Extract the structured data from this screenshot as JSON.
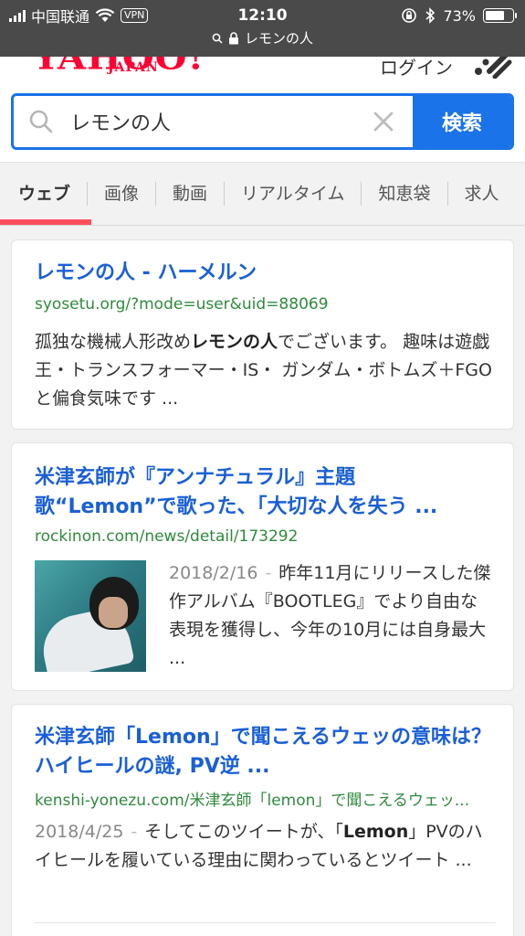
{
  "status_bar": {
    "carrier": "中国联通",
    "vpn": "VPN",
    "time": "12:10",
    "battery": "73%",
    "battery_level": 0.73,
    "url": "レモンの人"
  },
  "header": {
    "logo": "YAHOO!",
    "logo_sub": "JAPAN",
    "login": "ログイン"
  },
  "search": {
    "query": "レモンの人",
    "button": "検索"
  },
  "tabs": [
    "ウェブ",
    "画像",
    "動画",
    "リアルタイム",
    "知恵袋",
    "求人"
  ],
  "results": [
    {
      "title": "レモンの人 - ハーメルン",
      "url": "syosetu.org/?mode=user&uid=88069",
      "desc_pre": "孤独な機械人形改め",
      "desc_bold": "レモンの人",
      "desc_post": "でございます。 趣味は遊戯王・トランスフォーマー・IS・ ガンダム・ボトムズ＋FGOと偏食気味です ..."
    },
    {
      "title": "米津玄師が『アンナチュラル』主題歌“Lemon”で歌った、「大切な人を失う ...",
      "url": "rockinon.com/news/detail/173292",
      "date": "2018/2/16",
      "desc": "昨年11月にリリースした傑作アルバム『BOOTLEG』でより自由な表現を獲得し、今年の10月には自身最大 ..."
    },
    {
      "title": "米津玄師「Lemon」で聞こえるウェッの意味は？ハイヒールの謎, PV逆 ...",
      "url": "kenshi-yonezu.com/米津玄師「lemon」で聞こえるウェッ...",
      "date": "2018/4/25",
      "desc_pre": "そしてこのツイートが、「",
      "desc_bold": "Lemon",
      "desc_post": "」PVのハイヒールを履いている理由に関わっているとツイート ..."
    }
  ]
}
